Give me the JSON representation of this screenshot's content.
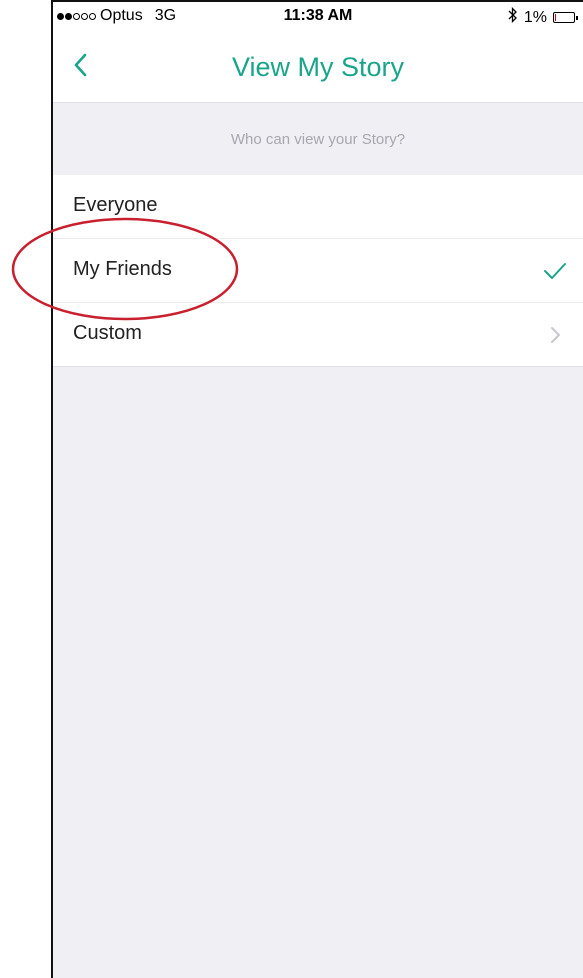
{
  "status_bar": {
    "carrier": "Optus",
    "network": "3G",
    "time": "11:38 AM",
    "battery": "1%",
    "signal_dots": [
      true,
      true,
      false,
      false,
      false
    ],
    "icons": [
      "bluetooth-icon",
      "battery-icon"
    ]
  },
  "nav": {
    "title": "View My Story",
    "back_icon": "chevron-left-icon"
  },
  "section": {
    "header": "Who can view your Story?"
  },
  "options": [
    {
      "label": "Everyone",
      "selected": false,
      "accessory": "none"
    },
    {
      "label": "My Friends",
      "selected": true,
      "accessory": "checkmark-icon"
    },
    {
      "label": "Custom",
      "selected": false,
      "accessory": "chevron-right-icon"
    }
  ],
  "colors": {
    "accent": "#1aa58b",
    "annotation": "#c8202f",
    "background": "#efeff4",
    "battery_low": "#d0021b"
  }
}
